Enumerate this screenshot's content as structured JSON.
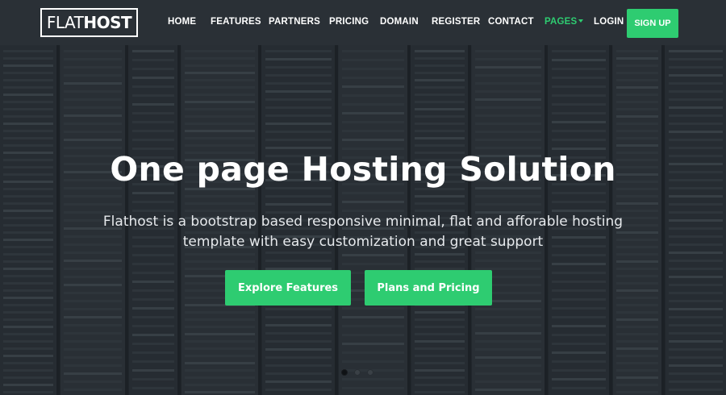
{
  "brand": {
    "light": "FLAT",
    "bold": "HOST"
  },
  "nav": {
    "items": [
      {
        "label": "HOME"
      },
      {
        "label": "FEATURES"
      },
      {
        "label": "PARTNERS"
      },
      {
        "label": "PRICING"
      },
      {
        "label": "DOMAIN"
      },
      {
        "label": "REGISTER"
      },
      {
        "label": "CONTACT"
      },
      {
        "label": "PAGES",
        "active": true,
        "has_dropdown": true
      },
      {
        "label": "LOGIN"
      }
    ],
    "signup_label": "SIGN UP"
  },
  "hero": {
    "title": "One page Hosting Solution",
    "subtitle": "Flathost is a bootstrap based responsive minimal, flat and afforable hosting template with easy customization and great support",
    "primary_button": "Explore Features",
    "secondary_button": "Plans and Pricing",
    "slides_count": 3,
    "active_slide": 1
  },
  "colors": {
    "accent": "#2ecc71",
    "navbar_bg": "#2a3036",
    "text": "#ffffff"
  },
  "icons": {
    "dropdown": "caret-down-icon"
  }
}
